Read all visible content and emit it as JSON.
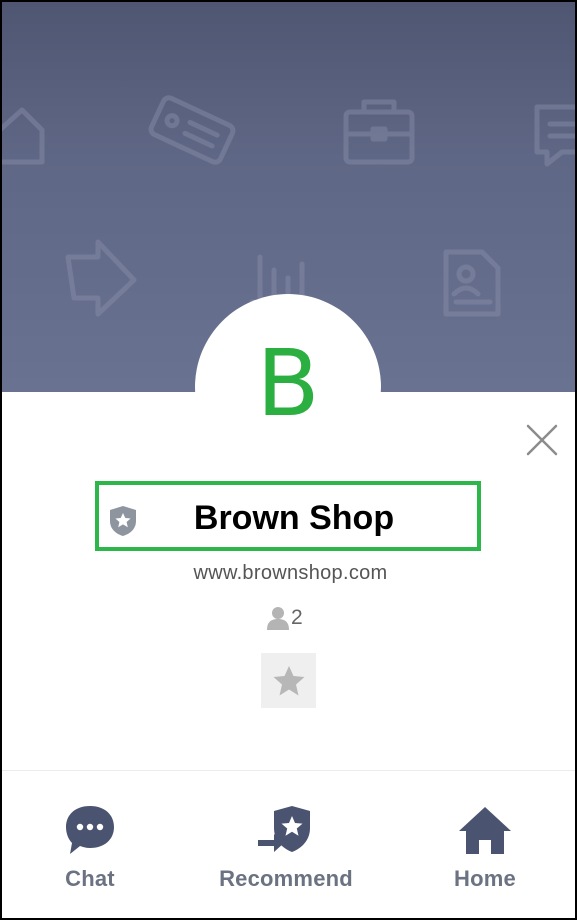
{
  "profile": {
    "avatar_letter": "B",
    "name": "Brown Shop",
    "url": "www.brownshop.com",
    "friends_count": "2"
  },
  "actions": {
    "chat_label": "Chat",
    "recommend_label": "Recommend",
    "home_label": "Home"
  },
  "colors": {
    "banner": "#5f6786",
    "avatar_letter": "#2aaf40",
    "highlight_border": "#2db74a",
    "action_icon": "#4a5470",
    "action_label": "#6b7282"
  },
  "icons": {
    "banner_pattern": [
      "home-icon",
      "tag-icon",
      "briefcase-icon",
      "chat-bubble-icon",
      "arrow-icon",
      "bar-chart-icon",
      "document-icon"
    ],
    "close": "close-icon",
    "badge": "shield-star-icon",
    "friends": "person-icon",
    "favorite": "star-icon"
  }
}
